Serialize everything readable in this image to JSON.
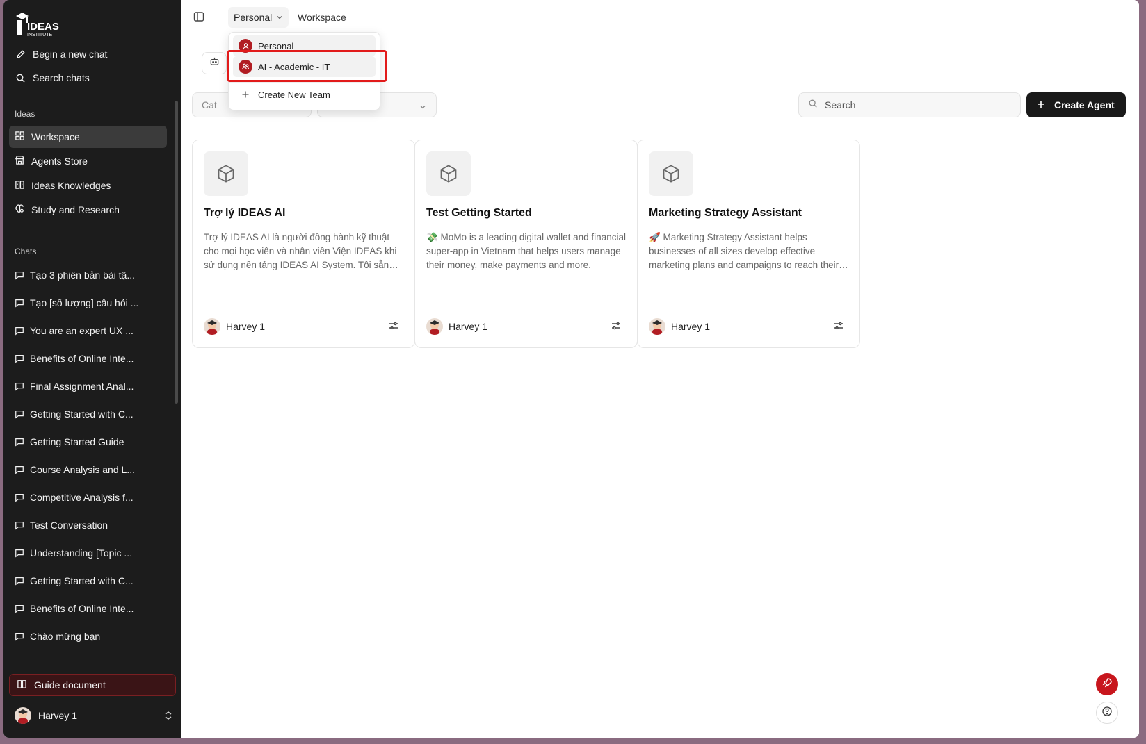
{
  "sidebar": {
    "brand_main": "IDEAS",
    "brand_sub": "INSTITUTE",
    "new_chat": "Begin a new chat",
    "search_chats": "Search chats",
    "ideas_section": "Ideas",
    "nav": [
      {
        "label": "Workspace",
        "icon": "grid-icon",
        "active": true
      },
      {
        "label": "Agents Store",
        "icon": "store-icon"
      },
      {
        "label": "Ideas Knowledges",
        "icon": "book-icon"
      },
      {
        "label": "Study and Research",
        "icon": "brain-icon"
      }
    ],
    "chats_section": "Chats",
    "chats": [
      "Tạo 3 phiên bản bài tậ...",
      "Tạo [số lượng] câu hỏi ...",
      "You are an expert UX ...",
      "Benefits of Online Inte...",
      "Final Assignment Anal...",
      "Getting Started with C...",
      "Getting Started Guide",
      "Course Analysis and L...",
      "Competitive Analysis f...",
      "Test Conversation",
      "Understanding [Topic ...",
      "Getting Started with C...",
      "Benefits of Online Inte...",
      "Chào mừng bạn"
    ],
    "guide": "Guide document",
    "user": "Harvey 1"
  },
  "topbar": {
    "context": "Personal",
    "breadcrumb": "Workspace"
  },
  "dropdown": {
    "personal": "Personal",
    "team": "AI - Academic - IT",
    "create_team": "Create New Team"
  },
  "filters": {
    "category_placeholder": "Cat",
    "search_placeholder": "Search",
    "create_agent": "Create Agent"
  },
  "cards": [
    {
      "title": "Trợ lý IDEAS AI",
      "desc": "Trợ lý IDEAS AI là người đồng hành kỹ thuật cho mọi học viên và nhân viên Viện IDEAS khi sử dụng nền tảng IDEAS AI System. Tôi sẵn sàng hỗ trợ bạn.",
      "owner": "Harvey 1"
    },
    {
      "title": "Test Getting Started",
      "desc": "💸 MoMo is a leading digital wallet and financial super-app in Vietnam that helps users manage their money, make payments and more.",
      "owner": "Harvey 1"
    },
    {
      "title": "Marketing Strategy Assistant",
      "desc": "🚀 Marketing Strategy Assistant helps businesses of all sizes develop effective marketing plans and campaigns to reach their goals.",
      "owner": "Harvey 1"
    }
  ],
  "colors": {
    "accent": "#c8161d",
    "sidebar_bg": "#1c1c1c",
    "highlight": "#e21b1b"
  }
}
